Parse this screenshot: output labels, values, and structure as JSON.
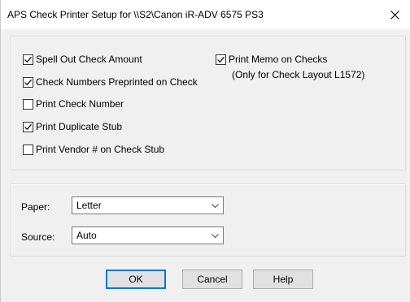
{
  "window": {
    "title": "APS Check Printer Setup for \\\\S2\\Canon iR-ADV 6575 PS3"
  },
  "options": [
    {
      "label": "Spell Out Check Amount",
      "checked": true
    },
    {
      "label": "Check Numbers Preprinted on Check",
      "checked": true
    },
    {
      "label": "Print Check Number",
      "checked": false
    },
    {
      "label": "Print Duplicate Stub",
      "checked": true
    },
    {
      "label": "Print Vendor # on Check Stub",
      "checked": false
    }
  ],
  "memo": {
    "label": "Print Memo on Checks",
    "checked": true,
    "note": "(Only for Check Layout L1572)"
  },
  "paper": {
    "label": "Paper:",
    "value": "Letter"
  },
  "source": {
    "label": "Source:",
    "value": "Auto"
  },
  "buttons": {
    "ok": "OK",
    "cancel": "Cancel",
    "help": "Help"
  },
  "icons": {
    "close": "close-icon",
    "dropdown": "chevron-down-icon",
    "check": "checkmark-icon"
  },
  "colors": {
    "default_button_border": "#0078d7",
    "button_face": "#e1e1e1",
    "dialog_bg": "#f0f0f0"
  }
}
